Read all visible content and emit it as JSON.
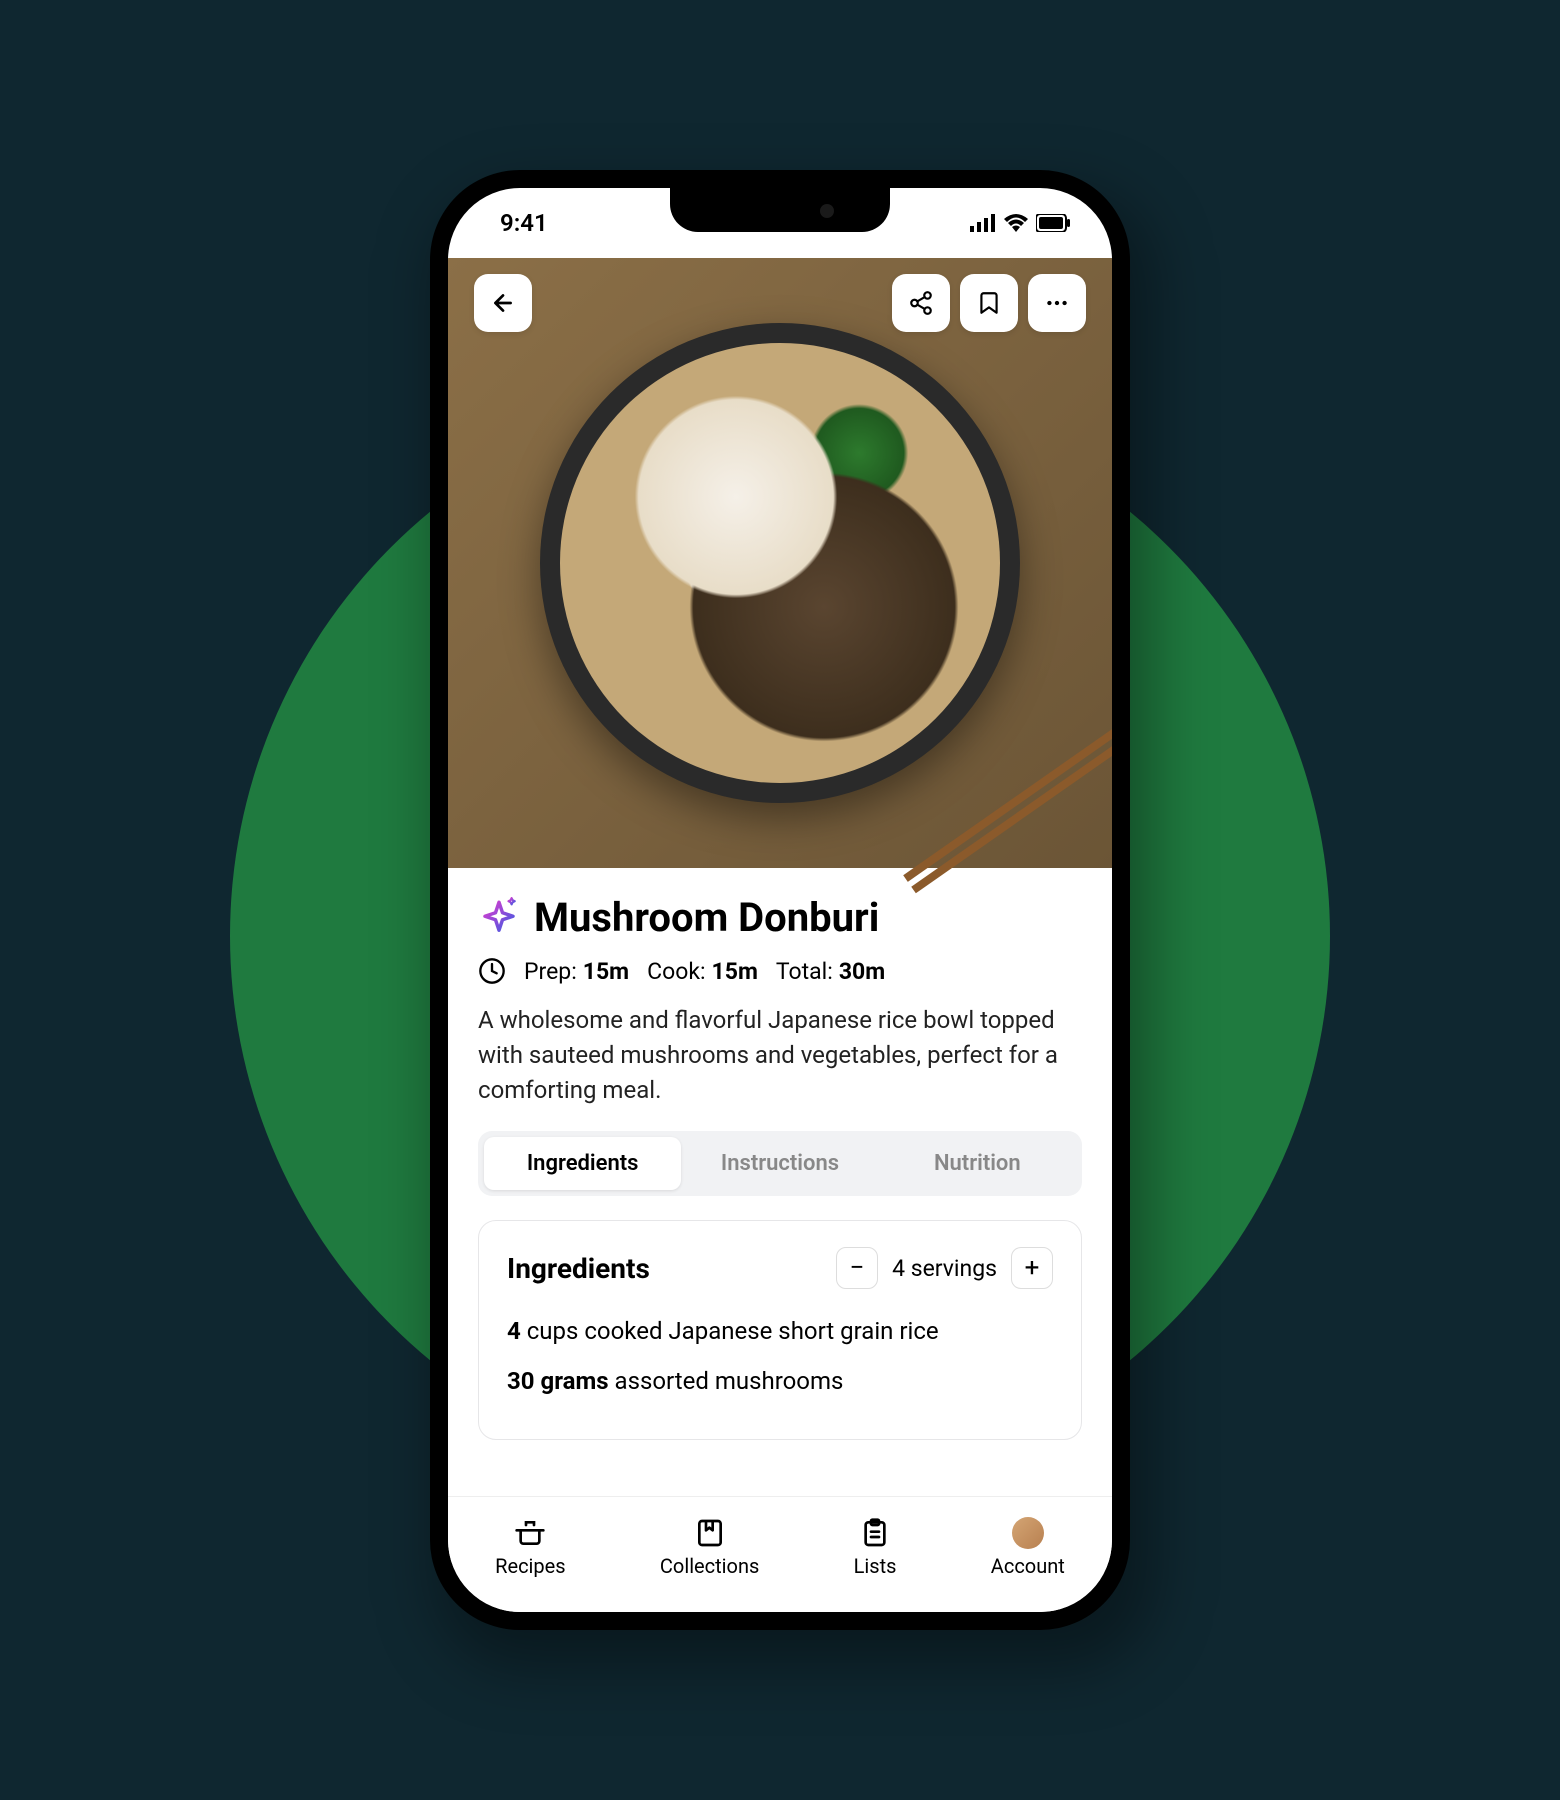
{
  "status": {
    "time": "9:41"
  },
  "recipe": {
    "title": "Mushroom Donburi",
    "prep_label": "Prep:",
    "prep_value": "15m",
    "cook_label": "Cook:",
    "cook_value": "15m",
    "total_label": "Total:",
    "total_value": "30m",
    "description": "A wholesome and flavorful Japanese rice bowl topped with sauteed mushrooms and vegetables, perfect for a comforting meal."
  },
  "tabs": {
    "ingredients": "Ingredients",
    "instructions": "Instructions",
    "nutrition": "Nutrition"
  },
  "ingredients": {
    "heading": "Ingredients",
    "servings_text": "4 servings",
    "items": [
      {
        "qty": "4",
        "rest": " cups cooked Japanese short grain rice"
      },
      {
        "qty": "30 grams",
        "rest": " assorted mushrooms"
      }
    ]
  },
  "nav": {
    "recipes": "Recipes",
    "collections": "Collections",
    "lists": "Lists",
    "account": "Account"
  }
}
